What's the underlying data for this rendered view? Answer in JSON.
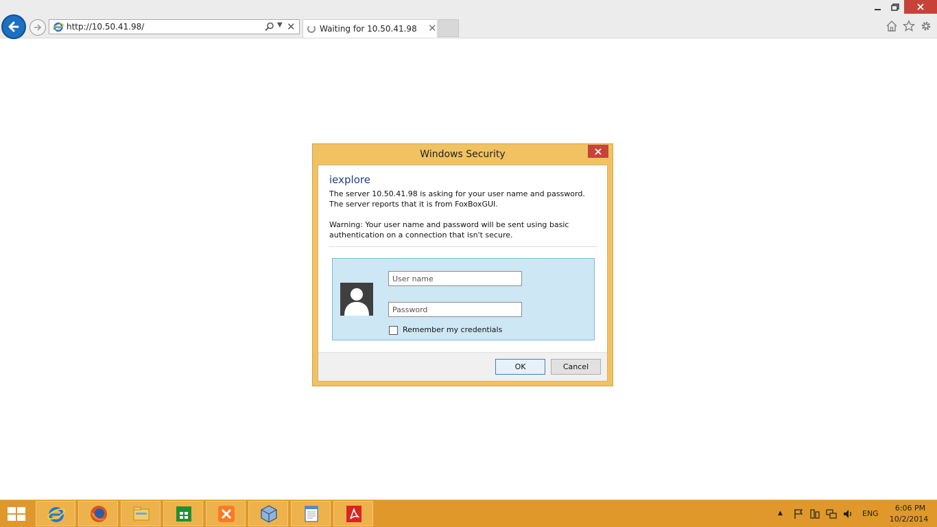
{
  "browser": {
    "url": "http://10.50.41.98/",
    "tab_title": "Waiting for 10.50.41.98"
  },
  "dialog": {
    "title": "Windows Security",
    "app_name": "iexplore",
    "message": "The server 10.50.41.98 is asking for your user name and password. The server reports that it is from FoxBoxGUI.",
    "warning": "Warning: Your user name and password will be sent using basic authentication on a connection that isn't secure.",
    "username_placeholder": "User name",
    "password_placeholder": "Password",
    "remember_label": "Remember my credentials",
    "remember_checked": false,
    "ok_label": "OK",
    "cancel_label": "Cancel"
  },
  "taskbar": {
    "apps": [
      "internet-explorer-icon",
      "firefox-icon",
      "file-explorer-icon",
      "store-icon",
      "xampp-icon",
      "virtualbox-icon",
      "notepad-icon",
      "acrobat-icon"
    ],
    "language": "ENG",
    "time": "6:06 PM",
    "date": "10/2/2014"
  },
  "colors": {
    "accent": "#1d6fc0",
    "dialog_frame": "#f0c262",
    "taskbar": "#e0982a",
    "close_red": "#c7433a",
    "credential_box": "#cde7f5",
    "app_name_blue": "#1e3b8e"
  }
}
